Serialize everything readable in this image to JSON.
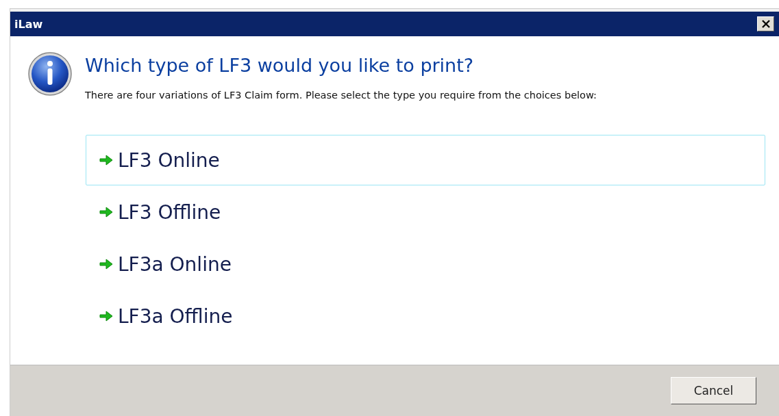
{
  "window": {
    "title": "iLaw"
  },
  "heading": "Which type of LF3 would you like to print?",
  "message": "There are four variations of LF3 Claim form. Please select the type you require from the choices below:",
  "choices": [
    {
      "label": "LF3 Online",
      "selected": true
    },
    {
      "label": "LF3 Offline",
      "selected": false
    },
    {
      "label": "LF3a Online",
      "selected": false
    },
    {
      "label": "LF3a Offline",
      "selected": false
    }
  ],
  "buttons": [
    "Cancel"
  ]
}
